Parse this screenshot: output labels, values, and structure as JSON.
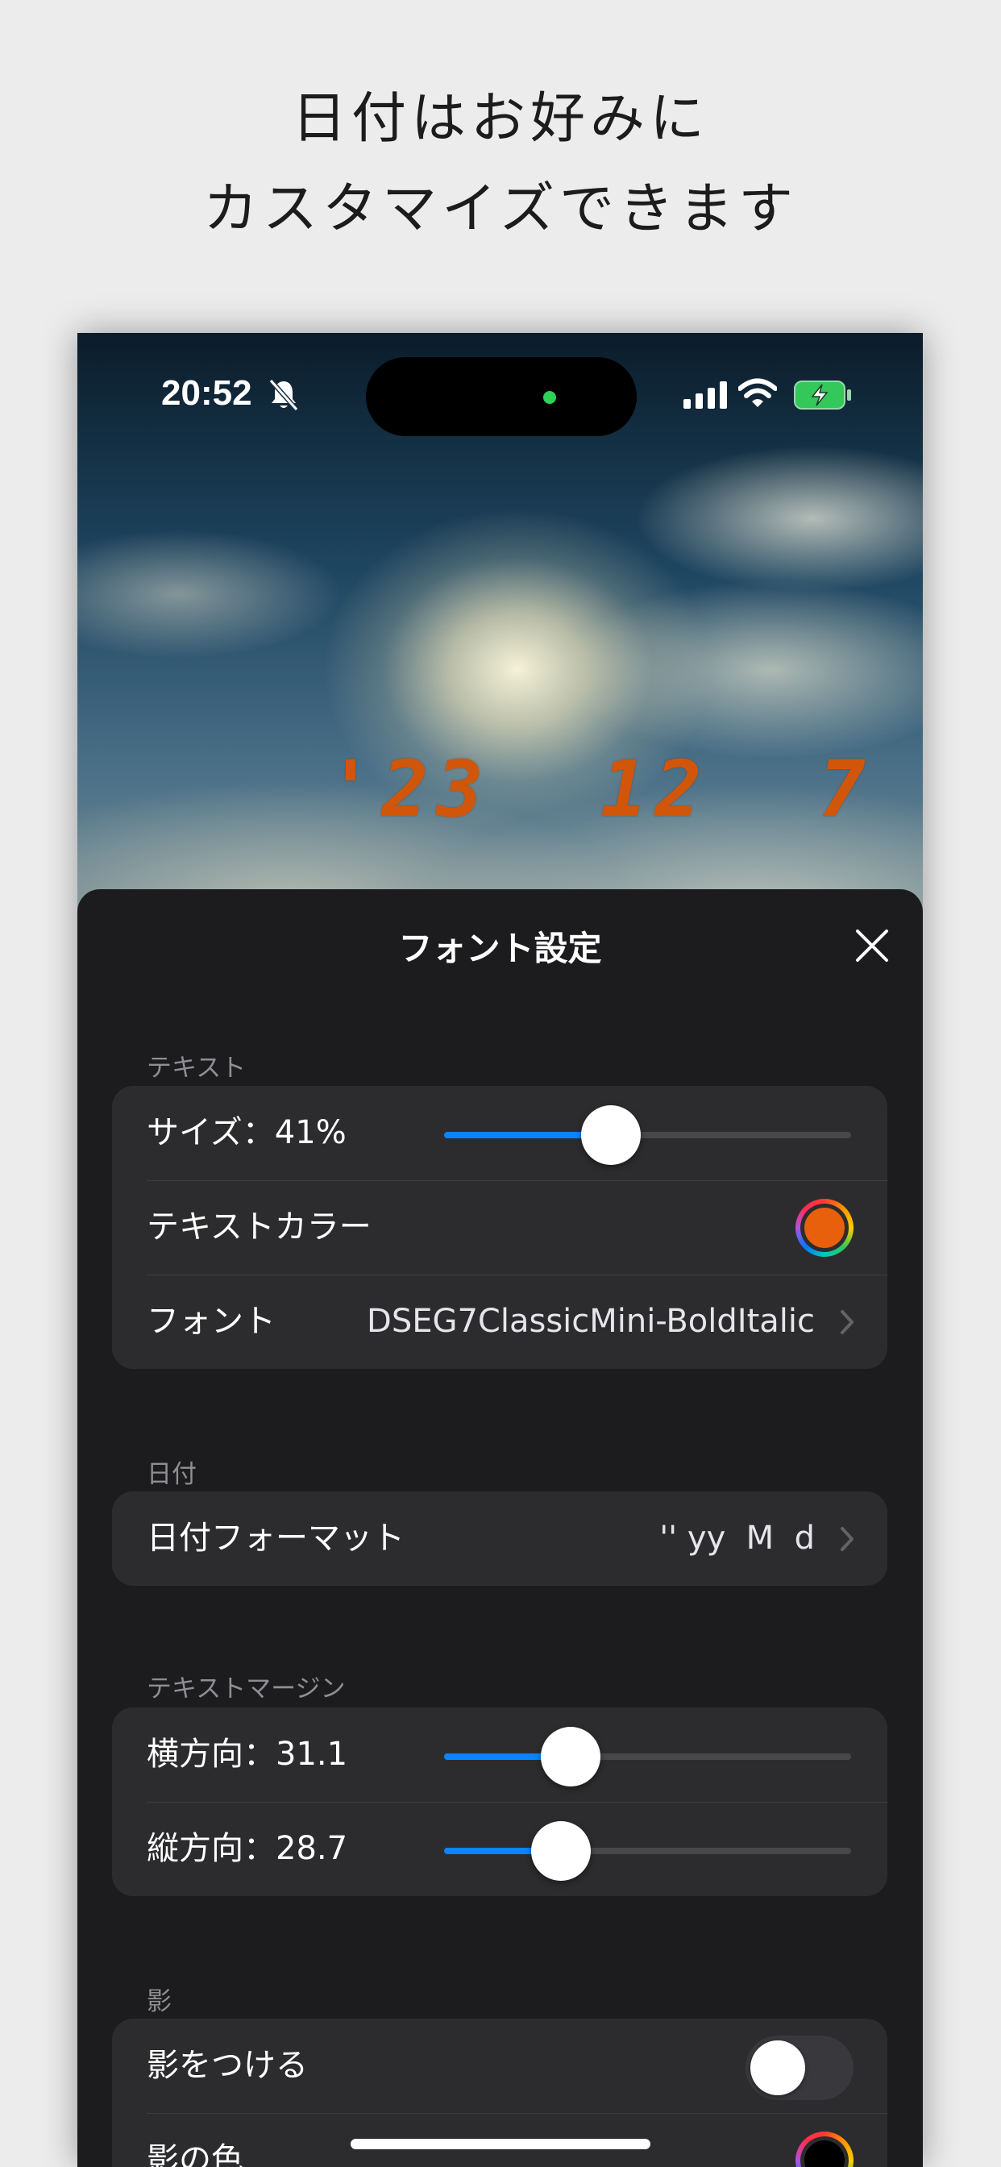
{
  "headline": {
    "line1": "日付はお好みに",
    "line2": "カスタマイズできます"
  },
  "status_bar": {
    "time": "20:52",
    "silent_icon": "bell-slash-icon",
    "signal_icon": "cellular-signal-icon",
    "wifi_icon": "wifi-icon",
    "battery_icon": "battery-charging-icon"
  },
  "wallpaper": {
    "date_preview": "'23  12  7",
    "date_color": "#d2560a"
  },
  "sheet": {
    "title": "フォント設定",
    "close_icon": "close-icon",
    "sections": {
      "text": {
        "label": "テキスト",
        "size_label": "サイズ：41%",
        "size_value": 0.41,
        "color_label": "テキストカラー",
        "color_value": "#e8600c",
        "font_label": "フォント",
        "font_value": "DSEG7ClassicMini-BoldItalic"
      },
      "date": {
        "label": "日付",
        "format_label": "日付フォーマット",
        "format_value": "'' yy  M  d"
      },
      "margin": {
        "label": "テキストマージン",
        "horizontal_label": "横方向：31.1",
        "horizontal_value": 31.1,
        "vertical_label": "縦方向：28.7",
        "vertical_value": 28.7
      },
      "shadow": {
        "label": "影",
        "toggle_label": "影をつける",
        "toggle_on": false,
        "color_label": "影の色",
        "color_value": "#000000"
      }
    }
  },
  "colors": {
    "accent": "#0a84ff",
    "sheet_background": "#1c1c1e",
    "group_background": "#2c2c2e",
    "page_background": "#ececec"
  }
}
